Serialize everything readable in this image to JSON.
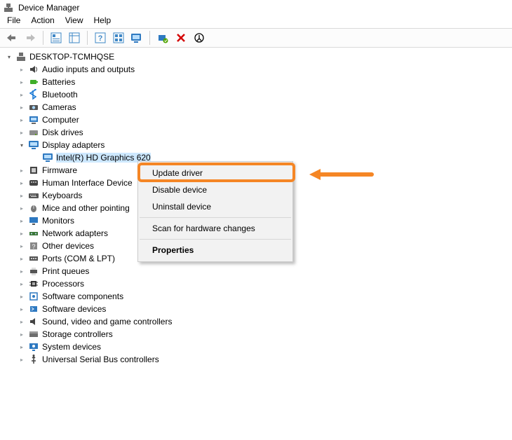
{
  "window": {
    "title": "Device Manager"
  },
  "menu": {
    "file": "File",
    "action": "Action",
    "view": "View",
    "help": "Help"
  },
  "root": {
    "name": "DESKTOP-TCMHQSE"
  },
  "categories": [
    {
      "label": "Audio inputs and outputs",
      "icon": "speaker"
    },
    {
      "label": "Batteries",
      "icon": "battery"
    },
    {
      "label": "Bluetooth",
      "icon": "bluetooth"
    },
    {
      "label": "Cameras",
      "icon": "camera"
    },
    {
      "label": "Computer",
      "icon": "computer"
    },
    {
      "label": "Disk drives",
      "icon": "disk"
    },
    {
      "label": "Display adapters",
      "icon": "display",
      "expanded": true,
      "children": [
        {
          "label": "Intel(R) HD Graphics 620",
          "icon": "display",
          "selected": true
        }
      ]
    },
    {
      "label": "Firmware",
      "icon": "firmware"
    },
    {
      "label": "Human Interface Device",
      "icon": "hid"
    },
    {
      "label": "Keyboards",
      "icon": "keyboard"
    },
    {
      "label": "Mice and other pointing",
      "icon": "mouse"
    },
    {
      "label": "Monitors",
      "icon": "monitor"
    },
    {
      "label": "Network adapters",
      "icon": "network"
    },
    {
      "label": "Other devices",
      "icon": "other"
    },
    {
      "label": "Ports (COM & LPT)",
      "icon": "port"
    },
    {
      "label": "Print queues",
      "icon": "printer"
    },
    {
      "label": "Processors",
      "icon": "cpu"
    },
    {
      "label": "Software components",
      "icon": "swcomp"
    },
    {
      "label": "Software devices",
      "icon": "swdev"
    },
    {
      "label": "Sound, video and game controllers",
      "icon": "sound"
    },
    {
      "label": "Storage controllers",
      "icon": "storage"
    },
    {
      "label": "System devices",
      "icon": "system"
    },
    {
      "label": "Universal Serial Bus controllers",
      "icon": "usb"
    }
  ],
  "context_menu": {
    "update": "Update driver",
    "disable": "Disable device",
    "uninstall": "Uninstall device",
    "scan": "Scan for hardware changes",
    "properties": "Properties"
  },
  "annotation": {
    "highlight_color": "#f58625"
  }
}
